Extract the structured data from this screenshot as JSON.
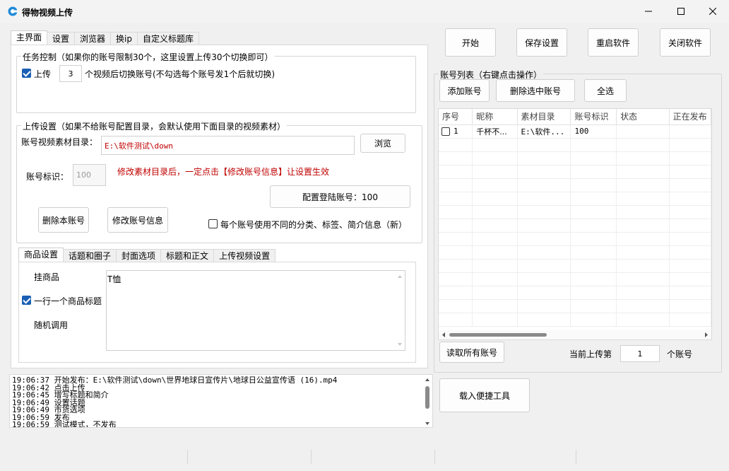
{
  "window": {
    "title": "得物视频上传",
    "accent": "#1a5fb4"
  },
  "top_buttons": {
    "start": "开始",
    "save_settings": "保存设置",
    "restart": "重启软件",
    "close_app": "关闭软件"
  },
  "left_tabs": [
    "主界面",
    "设置",
    "浏览器",
    "换ip",
    "自定义标题库"
  ],
  "task_control": {
    "title": "任务控制（如果你的账号限制30个，这里设置上传30个切换即可）",
    "upload_checked": true,
    "upload_label": "上传",
    "count_value": "3",
    "switch_text": "个视频后切换账号(不勾选每个账号发1个后就切换)"
  },
  "upload_settings": {
    "title": "上传设置（如果不给账号配置目录，会默认使用下面目录的视频素材）",
    "dir_label": "账号视频素材目录：",
    "dir_value": "E:\\软件测试\\down",
    "browse_label": "浏览",
    "account_id_label": "账号标识：",
    "account_id_placeholder": "100",
    "warning_text": "修改素材目录后，一定点击【修改账号信息】让设置生效",
    "config_login_label": "配置登陆账号：100",
    "delete_account_label": "删除本账号",
    "modify_account_label": "修改账号信息",
    "per_account_checked": false,
    "per_account_label": "每个账号使用不同的分类、标签、简介信息（新）"
  },
  "sub_tabs": [
    "商品设置",
    "话题和圈子",
    "封面选项",
    "标题和正文",
    "上传视频设置"
  ],
  "product": {
    "mount_label": "挂商品",
    "one_per_line_checked": true,
    "one_per_line_label": "一行一个商品标题",
    "random_label": "随机调用",
    "textarea_value": "T恤"
  },
  "log_lines": [
    "19:06:37 开始发布：E:\\软件测试\\down\\世界地球日宣传片\\地球日公益宣传语 (16).mp4",
    "19:06:42 点击上传",
    "19:06:45 增写标题和简介",
    "19:06:49 设置话题",
    "19:06:49 市货选项",
    "19:06:59 发布",
    "19:06:59 测试模式，不发布"
  ],
  "account_list": {
    "title": "账号列表（右键点击操作）",
    "add_label": "添加账号",
    "delete_selected_label": "删除选中账号",
    "select_all_label": "全选",
    "columns": [
      "序号",
      "昵称",
      "素材目录",
      "账号标识",
      "状态",
      "正在发布"
    ],
    "rows": [
      {
        "checked": false,
        "index": "1",
        "nickname": "千杯不...",
        "dir": "E:\\软件...",
        "account_id": "100",
        "status": "",
        "publishing": ""
      }
    ],
    "read_all_label": "读取所有账号",
    "current_upload_label": "当前上传第",
    "current_upload_value": "1",
    "current_upload_suffix": "个账号"
  },
  "load_tool_label": "载入便捷工具"
}
